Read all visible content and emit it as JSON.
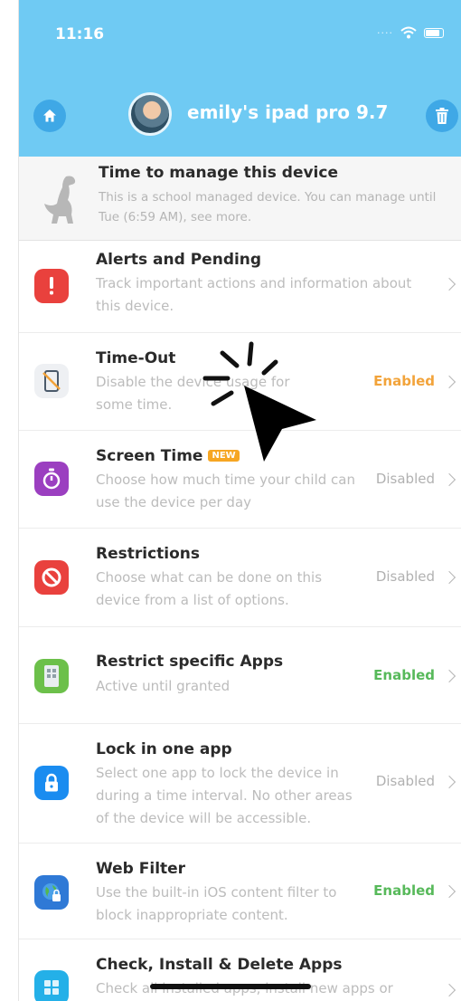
{
  "status_bar": {
    "time": "11:16"
  },
  "header": {
    "device_name": "emily's ipad pro 9.7",
    "home_icon": "home-icon",
    "trash_icon": "trash-icon"
  },
  "manage": {
    "title": "Time to manage this device",
    "desc": "This is a school managed device. You can manage until Tue (6:59 AM), see more."
  },
  "rows": [
    {
      "title": "Alerts and Pending",
      "desc": "Track important actions and information about this device.",
      "status": "",
      "icon": "alert-icon"
    },
    {
      "title": "Time-Out",
      "desc": "Disable the device usage for some time.",
      "status": "Enabled",
      "icon": "timeout-icon"
    },
    {
      "title": "Screen Time",
      "badge": "NEW",
      "desc": "Choose how much time your child can use the device per day",
      "status": "Disabled",
      "icon": "stopwatch-icon"
    },
    {
      "title": "Restrictions",
      "desc": "Choose what can be done on this device from a list of options.",
      "status": "Disabled",
      "icon": "restriction-icon"
    },
    {
      "title": "Restrict specific Apps",
      "desc": "Active until granted",
      "status": "Enabled",
      "icon": "apps-icon"
    },
    {
      "title": "Lock in one app",
      "desc": "Select one app to lock the device in during a time interval. No other areas of the device will be accessible.",
      "status": "Disabled",
      "icon": "lock-icon"
    },
    {
      "title": "Web Filter",
      "desc": "Use the built-in iOS content filter to block inappropriate content.",
      "status": "Enabled",
      "icon": "web-filter-icon"
    },
    {
      "title": "Check, Install & Delete Apps",
      "desc": "Check all installed apps, install new apps or",
      "status": "",
      "icon": "app-grid-icon"
    }
  ],
  "colors": {
    "header": "#6fcaf3",
    "enabled_orange": "#f2a33a",
    "enabled_green": "#57b95a",
    "disabled": "#b1b1b1"
  }
}
